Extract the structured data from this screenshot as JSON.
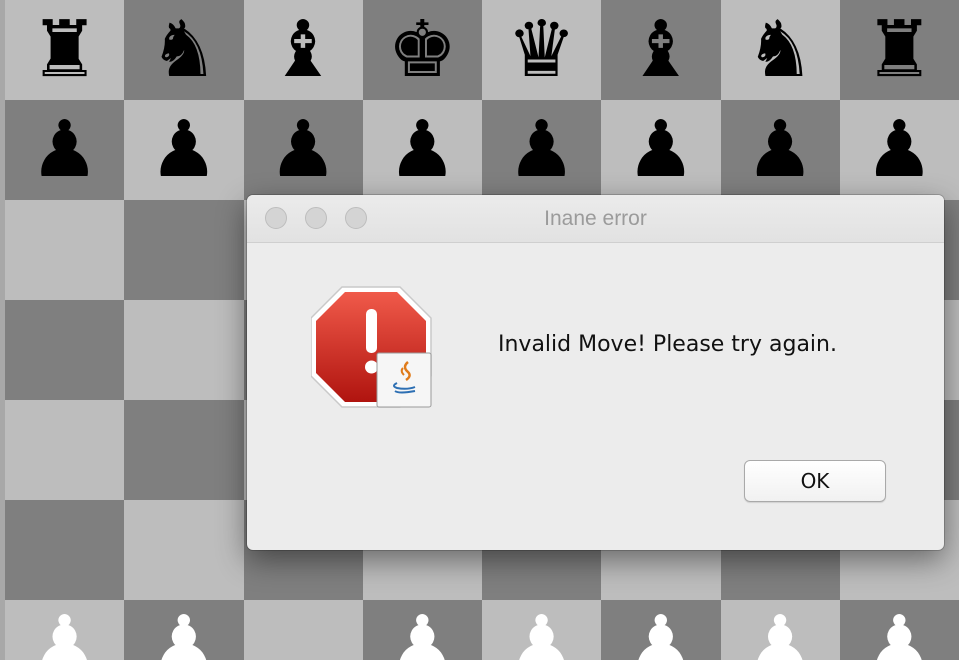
{
  "dialog": {
    "title": "Inane error",
    "message": "Invalid Move! Please try again.",
    "ok_label": "OK",
    "icon": "error-stop-icon",
    "badge_icon": "java-icon"
  },
  "board": {
    "light_color": "#bdbdbd",
    "dark_color": "#7f7f7f",
    "rows": [
      [
        "rook-black",
        "knight-black",
        "bishop-black",
        "king-black",
        "queen-black",
        "bishop-black",
        "knight-black",
        "rook-black"
      ],
      [
        "pawn-black",
        "pawn-black",
        "pawn-black",
        "pawn-black",
        "pawn-black",
        "pawn-black",
        "pawn-black",
        "pawn-black"
      ],
      [
        "",
        "",
        "",
        "",
        "",
        "",
        "",
        ""
      ],
      [
        "",
        "",
        "",
        "",
        "",
        "",
        "",
        ""
      ],
      [
        "",
        "",
        "",
        "",
        "",
        "",
        "",
        ""
      ],
      [
        "",
        "",
        "",
        "",
        "",
        "",
        "",
        ""
      ],
      [
        "pawn-white",
        "pawn-white",
        "",
        "pawn-white",
        "pawn-white",
        "pawn-white",
        "pawn-white",
        "pawn-white"
      ]
    ]
  }
}
